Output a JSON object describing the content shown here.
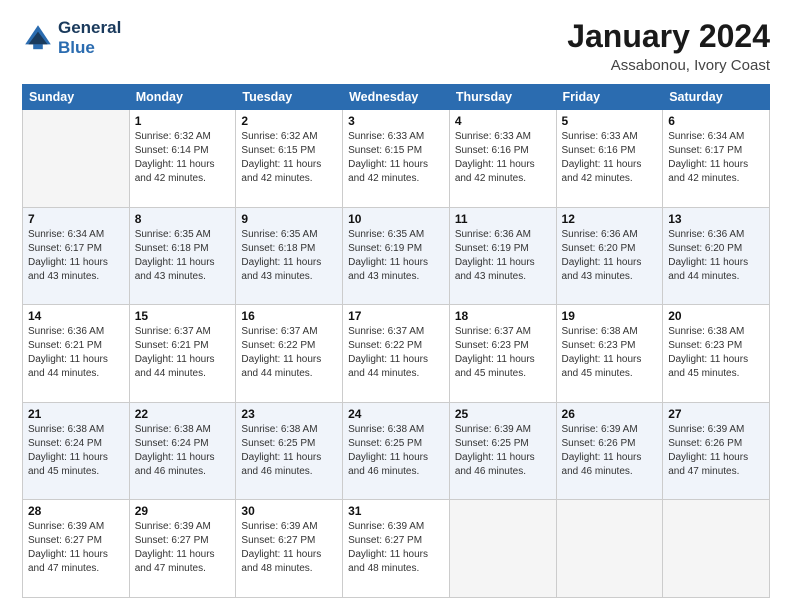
{
  "header": {
    "logo_line1": "General",
    "logo_line2": "Blue",
    "month": "January 2024",
    "location": "Assabonou, Ivory Coast"
  },
  "days_of_week": [
    "Sunday",
    "Monday",
    "Tuesday",
    "Wednesday",
    "Thursday",
    "Friday",
    "Saturday"
  ],
  "weeks": [
    [
      {
        "day": "",
        "empty": true
      },
      {
        "day": "1",
        "sunrise": "6:32 AM",
        "sunset": "6:14 PM",
        "daylight": "11 hours and 42 minutes."
      },
      {
        "day": "2",
        "sunrise": "6:32 AM",
        "sunset": "6:15 PM",
        "daylight": "11 hours and 42 minutes."
      },
      {
        "day": "3",
        "sunrise": "6:33 AM",
        "sunset": "6:15 PM",
        "daylight": "11 hours and 42 minutes."
      },
      {
        "day": "4",
        "sunrise": "6:33 AM",
        "sunset": "6:16 PM",
        "daylight": "11 hours and 42 minutes."
      },
      {
        "day": "5",
        "sunrise": "6:33 AM",
        "sunset": "6:16 PM",
        "daylight": "11 hours and 42 minutes."
      },
      {
        "day": "6",
        "sunrise": "6:34 AM",
        "sunset": "6:17 PM",
        "daylight": "11 hours and 42 minutes."
      }
    ],
    [
      {
        "day": "7",
        "sunrise": "6:34 AM",
        "sunset": "6:17 PM",
        "daylight": "11 hours and 43 minutes."
      },
      {
        "day": "8",
        "sunrise": "6:35 AM",
        "sunset": "6:18 PM",
        "daylight": "11 hours and 43 minutes."
      },
      {
        "day": "9",
        "sunrise": "6:35 AM",
        "sunset": "6:18 PM",
        "daylight": "11 hours and 43 minutes."
      },
      {
        "day": "10",
        "sunrise": "6:35 AM",
        "sunset": "6:19 PM",
        "daylight": "11 hours and 43 minutes."
      },
      {
        "day": "11",
        "sunrise": "6:36 AM",
        "sunset": "6:19 PM",
        "daylight": "11 hours and 43 minutes."
      },
      {
        "day": "12",
        "sunrise": "6:36 AM",
        "sunset": "6:20 PM",
        "daylight": "11 hours and 43 minutes."
      },
      {
        "day": "13",
        "sunrise": "6:36 AM",
        "sunset": "6:20 PM",
        "daylight": "11 hours and 44 minutes."
      }
    ],
    [
      {
        "day": "14",
        "sunrise": "6:36 AM",
        "sunset": "6:21 PM",
        "daylight": "11 hours and 44 minutes."
      },
      {
        "day": "15",
        "sunrise": "6:37 AM",
        "sunset": "6:21 PM",
        "daylight": "11 hours and 44 minutes."
      },
      {
        "day": "16",
        "sunrise": "6:37 AM",
        "sunset": "6:22 PM",
        "daylight": "11 hours and 44 minutes."
      },
      {
        "day": "17",
        "sunrise": "6:37 AM",
        "sunset": "6:22 PM",
        "daylight": "11 hours and 44 minutes."
      },
      {
        "day": "18",
        "sunrise": "6:37 AM",
        "sunset": "6:23 PM",
        "daylight": "11 hours and 45 minutes."
      },
      {
        "day": "19",
        "sunrise": "6:38 AM",
        "sunset": "6:23 PM",
        "daylight": "11 hours and 45 minutes."
      },
      {
        "day": "20",
        "sunrise": "6:38 AM",
        "sunset": "6:23 PM",
        "daylight": "11 hours and 45 minutes."
      }
    ],
    [
      {
        "day": "21",
        "sunrise": "6:38 AM",
        "sunset": "6:24 PM",
        "daylight": "11 hours and 45 minutes."
      },
      {
        "day": "22",
        "sunrise": "6:38 AM",
        "sunset": "6:24 PM",
        "daylight": "11 hours and 46 minutes."
      },
      {
        "day": "23",
        "sunrise": "6:38 AM",
        "sunset": "6:25 PM",
        "daylight": "11 hours and 46 minutes."
      },
      {
        "day": "24",
        "sunrise": "6:38 AM",
        "sunset": "6:25 PM",
        "daylight": "11 hours and 46 minutes."
      },
      {
        "day": "25",
        "sunrise": "6:39 AM",
        "sunset": "6:25 PM",
        "daylight": "11 hours and 46 minutes."
      },
      {
        "day": "26",
        "sunrise": "6:39 AM",
        "sunset": "6:26 PM",
        "daylight": "11 hours and 46 minutes."
      },
      {
        "day": "27",
        "sunrise": "6:39 AM",
        "sunset": "6:26 PM",
        "daylight": "11 hours and 47 minutes."
      }
    ],
    [
      {
        "day": "28",
        "sunrise": "6:39 AM",
        "sunset": "6:27 PM",
        "daylight": "11 hours and 47 minutes."
      },
      {
        "day": "29",
        "sunrise": "6:39 AM",
        "sunset": "6:27 PM",
        "daylight": "11 hours and 47 minutes."
      },
      {
        "day": "30",
        "sunrise": "6:39 AM",
        "sunset": "6:27 PM",
        "daylight": "11 hours and 48 minutes."
      },
      {
        "day": "31",
        "sunrise": "6:39 AM",
        "sunset": "6:27 PM",
        "daylight": "11 hours and 48 minutes."
      },
      {
        "day": "",
        "empty": true
      },
      {
        "day": "",
        "empty": true
      },
      {
        "day": "",
        "empty": true
      }
    ]
  ]
}
